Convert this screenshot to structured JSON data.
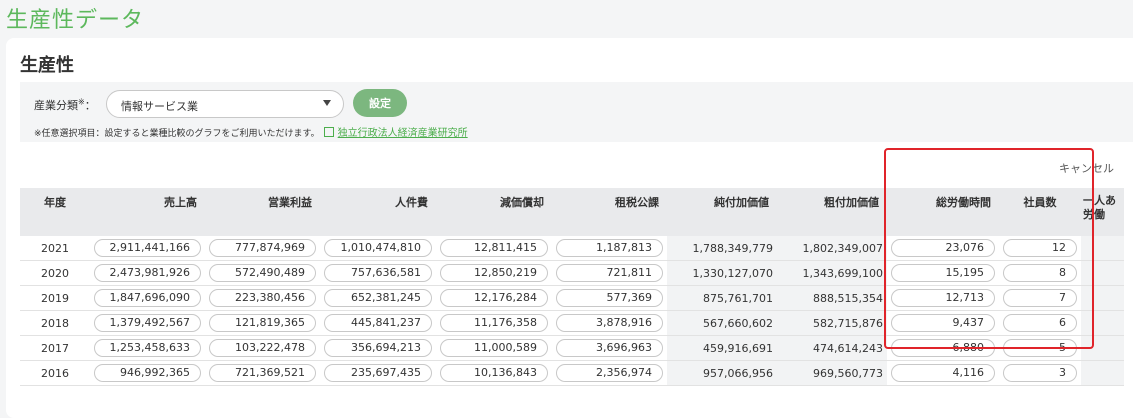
{
  "page_title": "生産性データ",
  "card_title": "生産性",
  "filter": {
    "label": "産業分類",
    "label_mark": "※",
    "label_colon": "：",
    "selected_value": "情報サービス業",
    "set_button_label": "設定",
    "note": "※任意選択項目：設定すると業種比較のグラフをご利用いただけます。",
    "link_text": "独立行政法人経済産業研究所"
  },
  "cancel_label": "キャンセル",
  "table": {
    "headers": [
      "年度",
      "売上高",
      "営業利益",
      "人件費",
      "減価償却",
      "租税公課",
      "純付加価値",
      "粗付加価値",
      "総労働時間",
      "社員数",
      "一人あ",
      "労働"
    ],
    "rows": [
      {
        "year": "2021",
        "sales": "2,911,441,166",
        "op_profit": "777,874,969",
        "labor": "1,010,474,810",
        "depreciation": "12,811,415",
        "tax": "1,187,813",
        "net_va": "1,788,349,779",
        "gross_va": "1,802,349,007",
        "hours": "23,076",
        "employees": "12"
      },
      {
        "year": "2020",
        "sales": "2,473,981,926",
        "op_profit": "572,490,489",
        "labor": "757,636,581",
        "depreciation": "12,850,219",
        "tax": "721,811",
        "net_va": "1,330,127,070",
        "gross_va": "1,343,699,100",
        "hours": "15,195",
        "employees": "8"
      },
      {
        "year": "2019",
        "sales": "1,847,696,090",
        "op_profit": "223,380,456",
        "labor": "652,381,245",
        "depreciation": "12,176,284",
        "tax": "577,369",
        "net_va": "875,761,701",
        "gross_va": "888,515,354",
        "hours": "12,713",
        "employees": "7"
      },
      {
        "year": "2018",
        "sales": "1,379,492,567",
        "op_profit": "121,819,365",
        "labor": "445,841,237",
        "depreciation": "11,176,358",
        "tax": "3,878,916",
        "net_va": "567,660,602",
        "gross_va": "582,715,876",
        "hours": "9,437",
        "employees": "6"
      },
      {
        "year": "2017",
        "sales": "1,253,458,633",
        "op_profit": "103,222,478",
        "labor": "356,694,213",
        "depreciation": "11,000,589",
        "tax": "3,696,963",
        "net_va": "459,916,691",
        "gross_va": "474,614,243",
        "hours": "6,880",
        "employees": "5"
      },
      {
        "year": "2016",
        "sales": "946,992,365",
        "op_profit": "721,369,521",
        "labor": "235,697,435",
        "depreciation": "10,136,843",
        "tax": "2,356,974",
        "net_va": "957,066,956",
        "gross_va": "969,560,773",
        "hours": "4,116",
        "employees": "3"
      }
    ]
  },
  "colors": {
    "accent": "#5cb85c",
    "button": "#7cb77f",
    "highlight": "#e0242a"
  }
}
